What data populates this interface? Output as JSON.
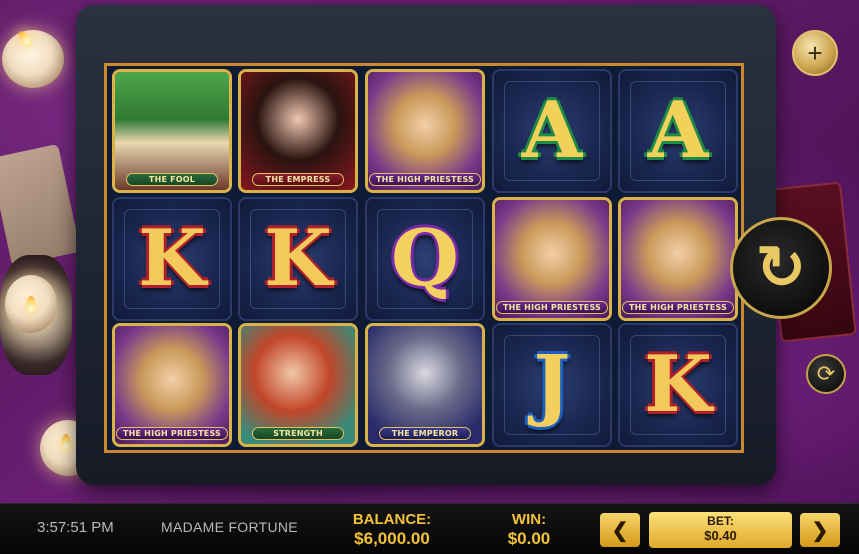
{
  "game": {
    "title": "MADAME FORTUNE",
    "time": "3:57:51 PM"
  },
  "reels": [
    [
      {
        "type": "card",
        "name": "THE FOOL"
      },
      {
        "type": "letter",
        "symbol": "K"
      },
      {
        "type": "card",
        "name": "THE HIGH PRIESTESS"
      }
    ],
    [
      {
        "type": "card",
        "name": "THE EMPRESS"
      },
      {
        "type": "letter",
        "symbol": "K"
      },
      {
        "type": "card",
        "name": "STRENGTH"
      }
    ],
    [
      {
        "type": "card",
        "name": "THE HIGH PRIESTESS"
      },
      {
        "type": "letter",
        "symbol": "Q"
      },
      {
        "type": "card",
        "name": "THE EMPEROR"
      }
    ],
    [
      {
        "type": "letter",
        "symbol": "A"
      },
      {
        "type": "card",
        "name": "THE HIGH PRIESTESS"
      },
      {
        "type": "letter",
        "symbol": "J"
      }
    ],
    [
      {
        "type": "letter",
        "symbol": "A"
      },
      {
        "type": "card",
        "name": "THE HIGH PRIESTESS"
      },
      {
        "type": "letter",
        "symbol": "K"
      }
    ]
  ],
  "controls": {
    "spin_icon": "refresh-arrow-icon",
    "add_icon": "plus-icon",
    "autoplay_icon": "autoplay-icon",
    "spin_glyph": "↻",
    "add_glyph": "+",
    "autoplay_glyph": "⟳"
  },
  "status": {
    "balance_label": "BALANCE:",
    "balance_value": "$6,000.00",
    "win_label": "WIN:",
    "win_value": "$0.00",
    "bet_label": "BET:",
    "bet_value": "$0.40",
    "bet_decrease_glyph": "❮",
    "bet_increase_glyph": "❯"
  }
}
